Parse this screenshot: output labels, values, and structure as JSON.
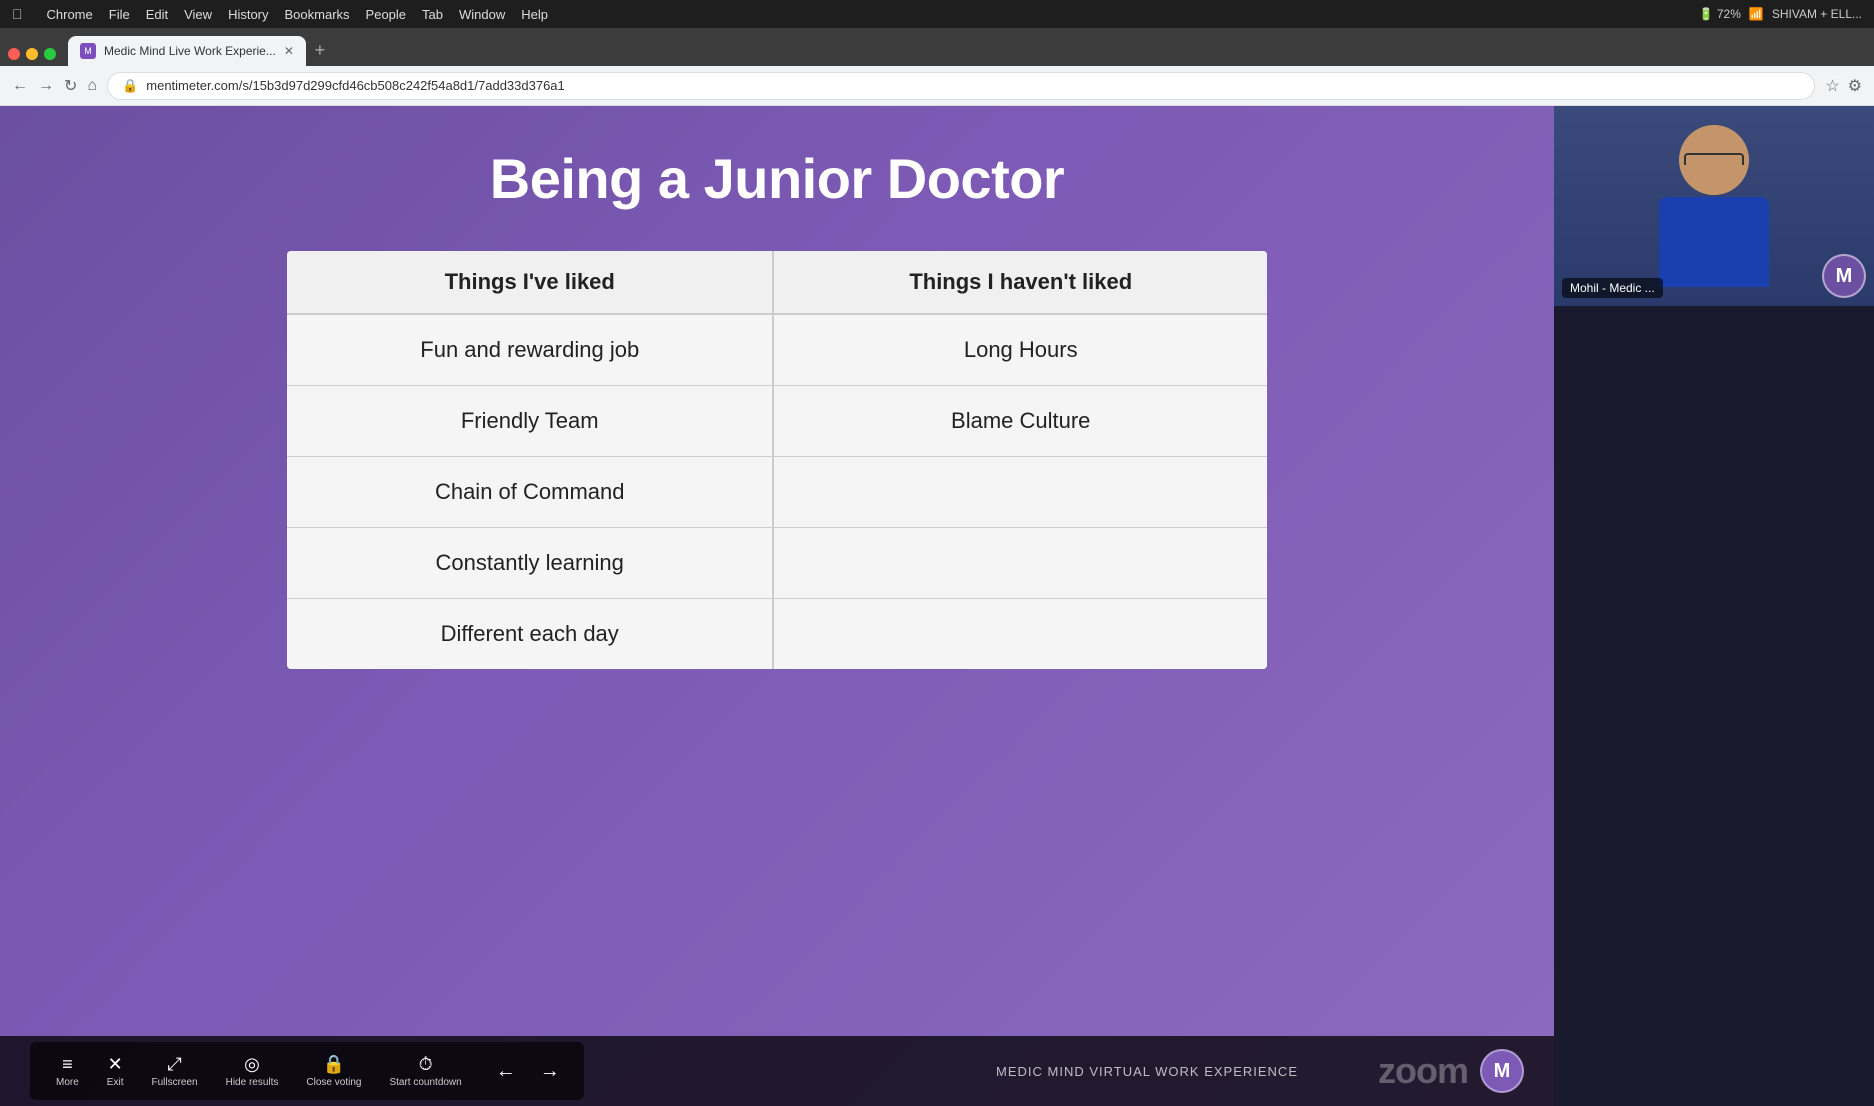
{
  "browser": {
    "menu_items": [
      "Chrome",
      "File",
      "Edit",
      "View",
      "History",
      "Bookmarks",
      "People",
      "Tab",
      "Window",
      "Help"
    ],
    "tab_title": "Medic Mind Live Work Experie...",
    "url": "mentimeter.com/s/15b3d97d299cfd46cb508c242f54a8d1/7add33d376a1",
    "nav_back": "←",
    "nav_forward": "→",
    "nav_refresh": "↻"
  },
  "slide": {
    "title": "Being a Junior Doctor",
    "table": {
      "col1_header": "Things I've liked",
      "col2_header": "Things I haven't liked",
      "rows": [
        {
          "liked": "Fun and rewarding job",
          "disliked": "Long Hours"
        },
        {
          "liked": "Friendly Team",
          "disliked": "Blame Culture"
        },
        {
          "liked": "Chain of Command",
          "disliked": ""
        },
        {
          "liked": "Constantly learning",
          "disliked": ""
        },
        {
          "liked": "Different each day",
          "disliked": ""
        }
      ]
    }
  },
  "bottom_bar": {
    "controls": [
      {
        "icon": "≡",
        "label": "More"
      },
      {
        "icon": "✕",
        "label": "Exit"
      },
      {
        "icon": "⤢",
        "label": "Fullscreen"
      },
      {
        "icon": "◎",
        "label": "Hide results"
      },
      {
        "icon": "🔒",
        "label": "Close voting"
      },
      {
        "icon": "⏱",
        "label": "Start countdown"
      }
    ],
    "nav_prev": "←",
    "nav_next": "→",
    "bottom_text": "MEDIC MIND VIRTUAL WORK EXPERIENCE"
  },
  "video": {
    "name_badge": "Mohil - Medic ...",
    "avatar_letter": "M"
  },
  "zoom": {
    "logo_text": "zoom",
    "m_badge": "M"
  },
  "colors": {
    "purple_bg": "#7c5ab5",
    "table_bg": "#f0f0f0",
    "bottom_bar_bg": "rgba(0,0,0,0.75)"
  }
}
